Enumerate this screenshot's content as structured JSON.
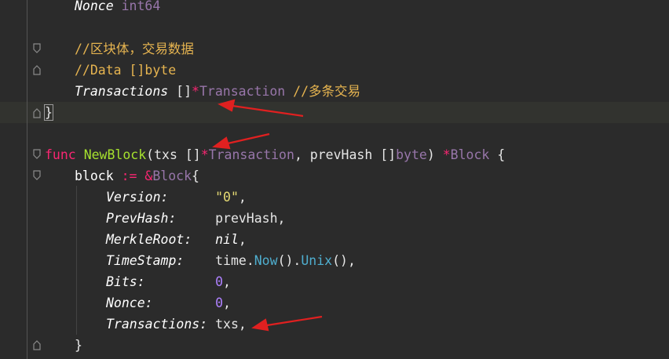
{
  "code": {
    "lines": [
      {
        "tokens": [
          {
            "text": "Nonce",
            "cls": "field"
          },
          {
            "text": " ",
            "cls": "plain"
          },
          {
            "text": "int64",
            "cls": "type"
          }
        ]
      },
      {
        "tokens": []
      },
      {
        "tokens": [
          {
            "text": "//区块体，交易数据",
            "cls": "cmt"
          }
        ]
      },
      {
        "tokens": [
          {
            "text": "//Data []byte",
            "cls": "cmt"
          }
        ]
      },
      {
        "tokens": [
          {
            "text": "Transactions",
            "cls": "field"
          },
          {
            "text": " []",
            "cls": "plain"
          },
          {
            "text": "*",
            "cls": "star"
          },
          {
            "text": "Transaction",
            "cls": "type"
          },
          {
            "text": " //多条交易",
            "cls": "cmt"
          }
        ]
      },
      {
        "tokens": [
          {
            "text": "}",
            "cls": "plain brace-box"
          }
        ]
      },
      {
        "tokens": []
      },
      {
        "tokens": [
          {
            "text": "func",
            "cls": "kw"
          },
          {
            "text": " ",
            "cls": "plain"
          },
          {
            "text": "NewBlock",
            "cls": "fn"
          },
          {
            "text": "(txs []",
            "cls": "plain"
          },
          {
            "text": "*",
            "cls": "star"
          },
          {
            "text": "Transaction",
            "cls": "type"
          },
          {
            "text": ", prevHash []",
            "cls": "plain"
          },
          {
            "text": "byte",
            "cls": "type"
          },
          {
            "text": ") ",
            "cls": "plain"
          },
          {
            "text": "*",
            "cls": "star"
          },
          {
            "text": "Block",
            "cls": "type"
          },
          {
            "text": " {",
            "cls": "plain"
          }
        ]
      },
      {
        "tokens": [
          {
            "text": "block",
            "cls": "pln2"
          },
          {
            "text": " := ",
            "cls": "kw"
          },
          {
            "text": "&",
            "cls": "kw"
          },
          {
            "text": "Block",
            "cls": "type"
          },
          {
            "text": "{",
            "cls": "plain"
          }
        ]
      },
      {
        "tokens": [
          {
            "text": "Version:",
            "cls": "field"
          },
          {
            "text": "      ",
            "cls": "plain"
          },
          {
            "text": "\"0\"",
            "cls": "str"
          },
          {
            "text": ",",
            "cls": "plain"
          }
        ]
      },
      {
        "tokens": [
          {
            "text": "PrevHash:",
            "cls": "field"
          },
          {
            "text": "     prevHash,",
            "cls": "plain"
          }
        ]
      },
      {
        "tokens": [
          {
            "text": "MerkleRoot:",
            "cls": "field"
          },
          {
            "text": "   ",
            "cls": "plain"
          },
          {
            "text": "nil",
            "cls": "nil"
          },
          {
            "text": ",",
            "cls": "plain"
          }
        ]
      },
      {
        "tokens": [
          {
            "text": "TimeStamp:",
            "cls": "field"
          },
          {
            "text": "    time.",
            "cls": "plain"
          },
          {
            "text": "Now",
            "cls": "call"
          },
          {
            "text": "().",
            "cls": "plain"
          },
          {
            "text": "Unix",
            "cls": "call"
          },
          {
            "text": "(),",
            "cls": "plain"
          }
        ]
      },
      {
        "tokens": [
          {
            "text": "Bits:",
            "cls": "field"
          },
          {
            "text": "         ",
            "cls": "plain"
          },
          {
            "text": "0",
            "cls": "num"
          },
          {
            "text": ",",
            "cls": "plain"
          }
        ]
      },
      {
        "tokens": [
          {
            "text": "Nonce:",
            "cls": "field"
          },
          {
            "text": "        ",
            "cls": "plain"
          },
          {
            "text": "0",
            "cls": "num"
          },
          {
            "text": ",",
            "cls": "plain"
          }
        ]
      },
      {
        "tokens": [
          {
            "text": "Transactions:",
            "cls": "field"
          },
          {
            "text": " txs,",
            "cls": "plain"
          }
        ]
      },
      {
        "tokens": [
          {
            "text": "}",
            "cls": "plain"
          }
        ]
      }
    ]
  }
}
